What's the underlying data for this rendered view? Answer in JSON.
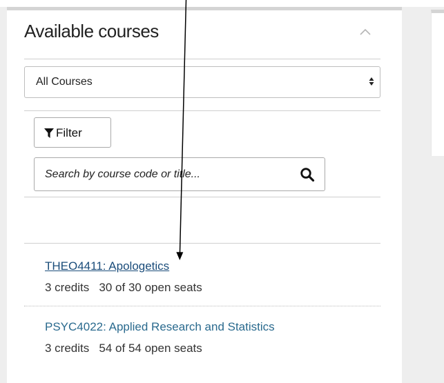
{
  "panel": {
    "title": "Available courses"
  },
  "course_filter": {
    "selected": "All Courses",
    "options": [
      "All Courses"
    ]
  },
  "filter_button": {
    "label": "Filter"
  },
  "search": {
    "placeholder": "Search by course code or title...",
    "value": ""
  },
  "courses": [
    {
      "title": "THEO4411: Apologetics",
      "credits": "3 credits",
      "seats": "30 of 30 open seats"
    },
    {
      "title": "PSYC4022: Applied Research and Statistics",
      "credits": "3 credits",
      "seats": "54 of 54 open seats"
    }
  ],
  "icons": {
    "collapse": "chevron-up-icon",
    "select_caret": "sort-caret-icon",
    "filter": "funnel-icon",
    "search": "search-icon"
  },
  "colors": {
    "link": "#2a6a8e",
    "visited_link": "#1a4c7a",
    "panel_border": "#d4d4d4",
    "background": "#eeeeee"
  }
}
